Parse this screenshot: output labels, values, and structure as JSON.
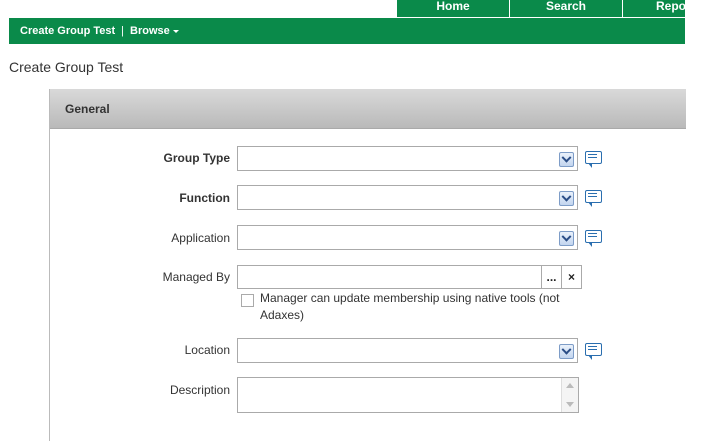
{
  "top_tabs": {
    "home": "Home",
    "search": "Search",
    "reports": "Repo"
  },
  "toolbar": {
    "crumb": "Create Group Test",
    "separator": "|",
    "browse": "Browse"
  },
  "page_title": "Create Group Test",
  "panel": {
    "header": "General"
  },
  "fields": {
    "group_type": "Group Type",
    "function": "Function",
    "application": "Application",
    "managed_by": "Managed By",
    "managed_by_checkbox": "Manager can update membership using native tools (not Adaxes)",
    "location": "Location",
    "description": "Description"
  },
  "buttons": {
    "browse": "...",
    "clear": "×"
  },
  "colors": {
    "brand_green": "#0a8a4a",
    "header_gray": "#c9c9c9"
  }
}
